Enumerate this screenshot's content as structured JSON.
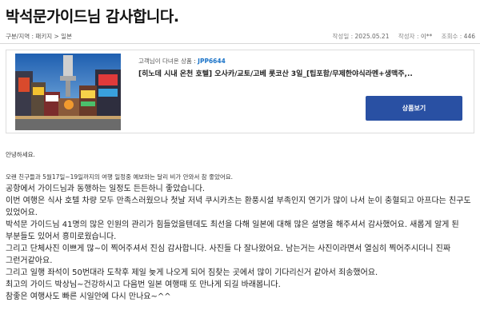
{
  "post": {
    "title": "박석문가이드님 감사합니다.",
    "breadcrumb": "구분/지역 : 패키지 > 일본",
    "date_label": "작성일 : ",
    "date": "2025.05.21",
    "author_label": "작성자 : ",
    "author": "이**",
    "views_label": "조회수 : ",
    "views": "446"
  },
  "product": {
    "prefix": "고객님이 다녀온 상품 : ",
    "code": "JPP6644",
    "title": "[히노데 시내 온천 호텔] 오사카/교토/고베 롯코산 3일_[팁포함/무제한야식라멘+생맥주,..",
    "button_label": "상품보기",
    "image_icon": "osaka-dotonbori-photo"
  },
  "content": {
    "greeting": "안녕하세요.",
    "intro": "오랜 친구들과 5월17일~19일까지의 여행 일정중  예보와는 달리 비가 안와서 참 좋았어요.",
    "lines": [
      "공항에서 가이드님과 동행하는 일정도 든든하니 좋았습니다.",
      "이번 여행은 식사 호텔 차량 모두 만족스러웠으나 첫날 저녁 쿠시카츠는 환풍시설 부족인지 연기가 많이 나서 눈이 충혈되고 아프다는 친구도 있었어요.",
      "박석문 가이드님 41명의 많은 인원의 관리가 힘들었을텐데도 최선을 다해 일본에 대해 많은 설명을 해주셔서 감사했어요. 새롭게 알게 된 부분들도 있어서 흥미로웠습니다.",
      "그리고 단체사진 이쁘게 많~이 찍어주셔서 진심 감사합니다. 사진들 다 잘나왔어요. 남는거는 사진이라면서 열심히 찍어주시더니 진짜 그런거같아요.",
      "그리고 일행 좌석이 50번대라 도착후 제일 늦게 나오게 되어 짐찾는 곳에서 많이 기다리신거 같아서 죄송했어요.",
      "최고의 가이드 박상님~건강하시고 다음번 일본 여행때 또 만나게 되길 바래봅니다.",
      "참좋은 여행사도 빠른 시일안에 다시 만나요~^^"
    ]
  }
}
